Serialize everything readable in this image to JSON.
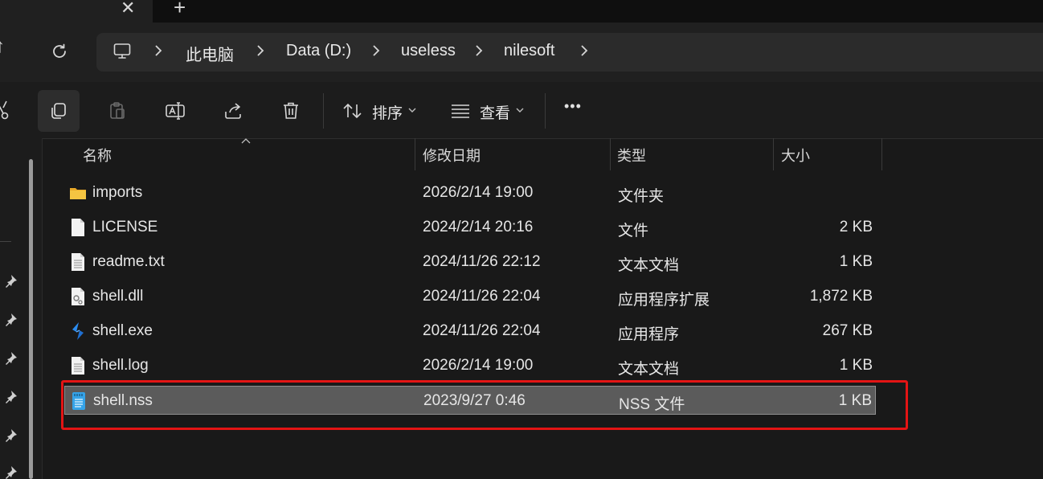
{
  "tabbar": {
    "close_glyph": "✕",
    "new_tab_glyph": "+"
  },
  "nav": {
    "breadcrumbs": [
      "此电脑",
      "Data (D:)",
      "useless",
      "nilesoft"
    ]
  },
  "toolbar": {
    "sort_label": "排序",
    "view_label": "查看",
    "more_glyph": "•••"
  },
  "columns": {
    "name": "名称",
    "date": "修改日期",
    "type": "类型",
    "size": "大小"
  },
  "files": [
    {
      "name": "imports",
      "date": "2026/2/14 19:00",
      "type": "文件夹",
      "size": "",
      "icon": "folder-icon"
    },
    {
      "name": "LICENSE",
      "date": "2024/2/14 20:16",
      "type": "文件",
      "size": "2 KB",
      "icon": "file-icon"
    },
    {
      "name": "readme.txt",
      "date": "2024/11/26 22:12",
      "type": "文本文档",
      "size": "1 KB",
      "icon": "text-file-icon"
    },
    {
      "name": "shell.dll",
      "date": "2024/11/26 22:04",
      "type": "应用程序扩展",
      "size": "1,872 KB",
      "icon": "dll-file-icon"
    },
    {
      "name": "shell.exe",
      "date": "2024/11/26 22:04",
      "type": "应用程序",
      "size": "267 KB",
      "icon": "nilesoft-app-icon"
    },
    {
      "name": "shell.log",
      "date": "2026/2/14 19:00",
      "type": "文本文档",
      "size": "1 KB",
      "icon": "text-file-icon"
    },
    {
      "name": "shell.nss",
      "date": "2023/9/27 0:46",
      "type": "NSS 文件",
      "size": "1 KB",
      "icon": "nss-file-icon",
      "selected": true
    }
  ],
  "colors": {
    "highlight_box": "#e31414",
    "selection": "#5b5b5b",
    "folder": "#f5c542",
    "accent": "#2b8cf0"
  }
}
